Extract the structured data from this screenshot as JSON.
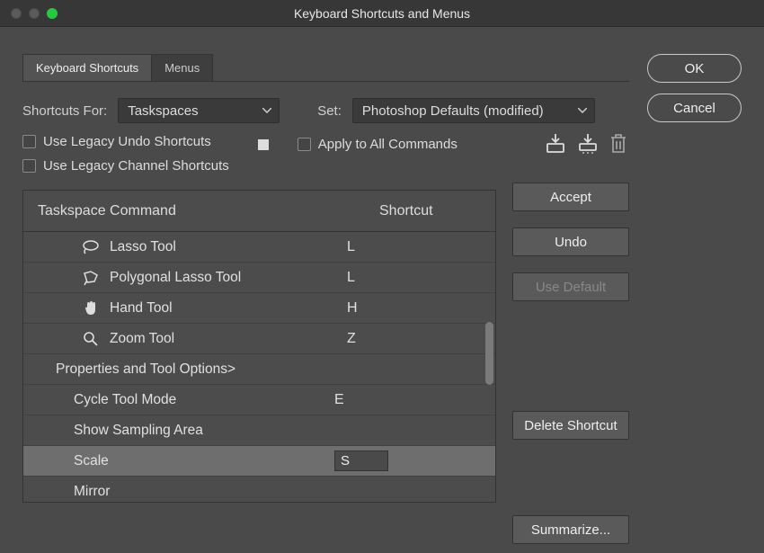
{
  "window": {
    "title": "Keyboard Shortcuts and Menus"
  },
  "tabs": [
    {
      "label": "Keyboard Shortcuts",
      "active": true
    },
    {
      "label": "Menus",
      "active": false
    }
  ],
  "controls": {
    "shortcuts_for_label": "Shortcuts For:",
    "shortcuts_for_value": "Taskspaces",
    "set_label": "Set:",
    "set_value": "Photoshop Defaults (modified)"
  },
  "checkboxes": {
    "legacy_undo": "Use Legacy Undo Shortcuts",
    "legacy_channel": "Use Legacy Channel Shortcuts",
    "apply_all": "Apply to All Commands"
  },
  "table": {
    "header_command": "Taskspace Command",
    "header_shortcut": "Shortcut",
    "rows": [
      {
        "type": "tool",
        "icon": "lasso",
        "label": "Lasso Tool",
        "shortcut": "L"
      },
      {
        "type": "tool",
        "icon": "polylasso",
        "label": "Polygonal Lasso Tool",
        "shortcut": "L"
      },
      {
        "type": "tool",
        "icon": "hand",
        "label": "Hand Tool",
        "shortcut": "H"
      },
      {
        "type": "tool",
        "icon": "zoom",
        "label": "Zoom Tool",
        "shortcut": "Z"
      },
      {
        "type": "group",
        "label": "Properties and Tool Options>"
      },
      {
        "type": "sub",
        "label": "Cycle Tool Mode",
        "shortcut": "E"
      },
      {
        "type": "sub",
        "label": "Show Sampling Area",
        "shortcut": ""
      },
      {
        "type": "sub",
        "label": "Scale",
        "shortcut": "S",
        "selected": true,
        "editing": true
      },
      {
        "type": "sub",
        "label": "Mirror",
        "shortcut": ""
      }
    ]
  },
  "side_buttons": {
    "accept": "Accept",
    "undo": "Undo",
    "use_default": "Use Default",
    "delete_shortcut": "Delete Shortcut",
    "summarize": "Summarize..."
  },
  "dialog_buttons": {
    "ok": "OK",
    "cancel": "Cancel"
  }
}
